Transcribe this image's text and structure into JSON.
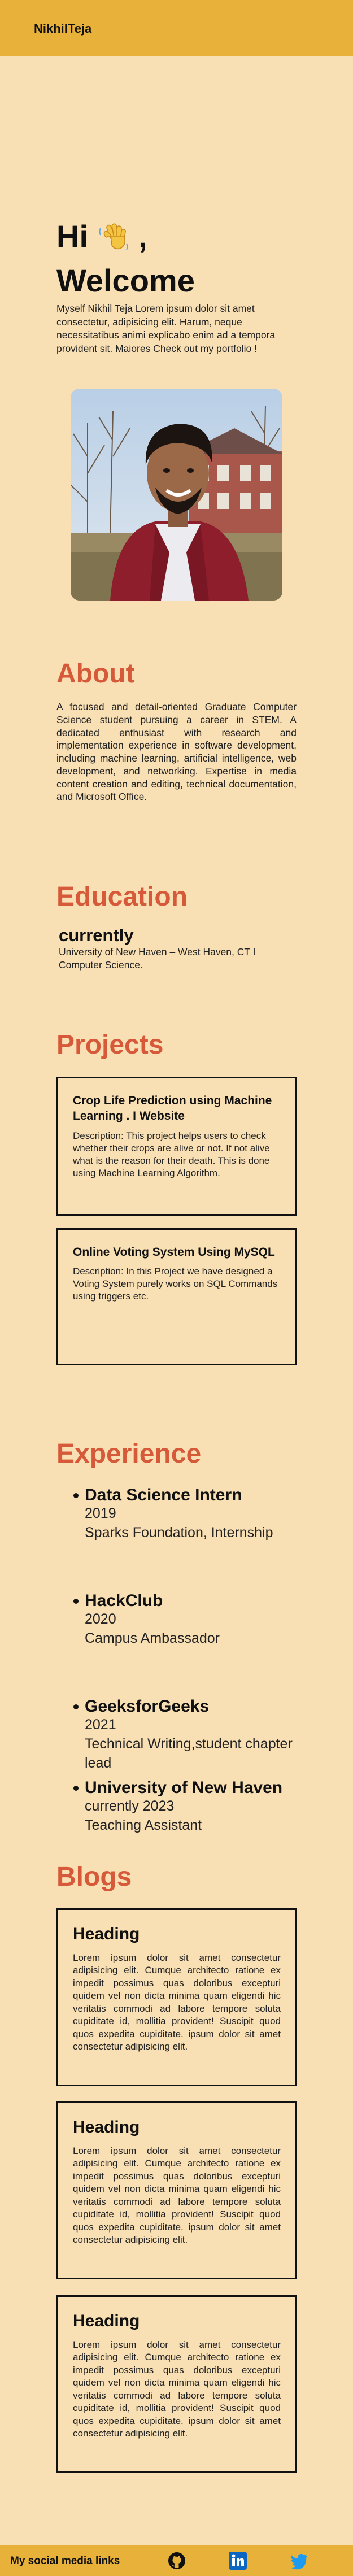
{
  "header": {
    "brand": "NikhilTeja"
  },
  "hero": {
    "greeting": "Hi",
    "greeting_suffix": ",",
    "welcome": "Welcome",
    "hand_icon": "waving-hand-icon",
    "intro": "Myself Nikhil Teja Lorem ipsum dolor sit amet consectetur, adipisicing elit. Harum, neque necessitatibus animi explicabo enim ad a tempora provident sit. Maiores Check out my portfolio !"
  },
  "about": {
    "title": "About",
    "text": "A focused and detail-oriented Graduate Computer Science student pursuing a career in STEM. A dedicated enthusiast with research and implementation experience in software development, including machine learning, artificial intelligence, web development, and networking. Expertise in media content creation and editing, technical documentation, and Microsoft Office."
  },
  "education": {
    "title": "Education",
    "status": "currently",
    "detail": "University of New Haven – West Haven, CT I Computer Science."
  },
  "projects": {
    "title": "Projects",
    "items": [
      {
        "title": "Crop Life Prediction using Machine Learning . I Website",
        "description": "Description: This project helps users to check whether their crops are alive or not. If not alive what is the reason for their death. This is done using Machine Learning Algorithm."
      },
      {
        "title": "Online Voting System Using MySQL",
        "description": "Description: In this Project we have designed a Voting System purely works on SQL Commands using triggers etc."
      }
    ]
  },
  "experience": {
    "title": "Experience",
    "items": [
      {
        "title": "Data Science Intern",
        "year": "2019",
        "detail": "Sparks Foundation, Internship"
      },
      {
        "title": "HackClub",
        "year": "2020",
        "detail": "Campus Ambassador"
      },
      {
        "title": "GeeksforGeeks",
        "year": "2021",
        "detail": "Technical Writing,student chapter lead"
      },
      {
        "title": "University of New Haven",
        "year": "currently 2023",
        "detail": "Teaching Assistant"
      }
    ]
  },
  "blogs": {
    "title": "Blogs",
    "items": [
      {
        "heading": "Heading",
        "body": "Lorem ipsum dolor sit amet consectetur adipisicing elit. Cumque architecto ratione ex impedit possimus quas doloribus excepturi quidem vel non dicta minima quam eligendi hic veritatis commodi ad labore tempore soluta cupiditate id, mollitia provident! Suscipit quod quos expedita cupiditate. ipsum dolor sit amet consectetur adipisicing elit."
      },
      {
        "heading": "Heading",
        "body": "Lorem ipsum dolor sit amet consectetur adipisicing elit. Cumque architecto ratione ex impedit possimus quas doloribus excepturi quidem vel non dicta minima quam eligendi hic veritatis commodi ad labore tempore soluta cupiditate id, mollitia provident! Suscipit quod quos expedita cupiditate. ipsum dolor sit amet consectetur adipisicing elit."
      },
      {
        "heading": "Heading",
        "body": "Lorem ipsum dolor sit amet consectetur adipisicing elit. Cumque architecto ratione ex impedit possimus quas doloribus excepturi quidem vel non dicta minima quam eligendi hic veritatis commodi ad labore tempore soluta cupiditate id, mollitia provident! Suscipit quod quos expedita cupiditate. ipsum dolor sit amet consectetur adipisicing elit."
      }
    ]
  },
  "footer": {
    "label": "My social media links",
    "icons": [
      "github-icon",
      "linkedin-icon",
      "twitter-icon"
    ]
  },
  "colors": {
    "background": "#f8dfb4",
    "header": "#e8b13a",
    "accent": "#d65a3a",
    "text": "#111111"
  }
}
